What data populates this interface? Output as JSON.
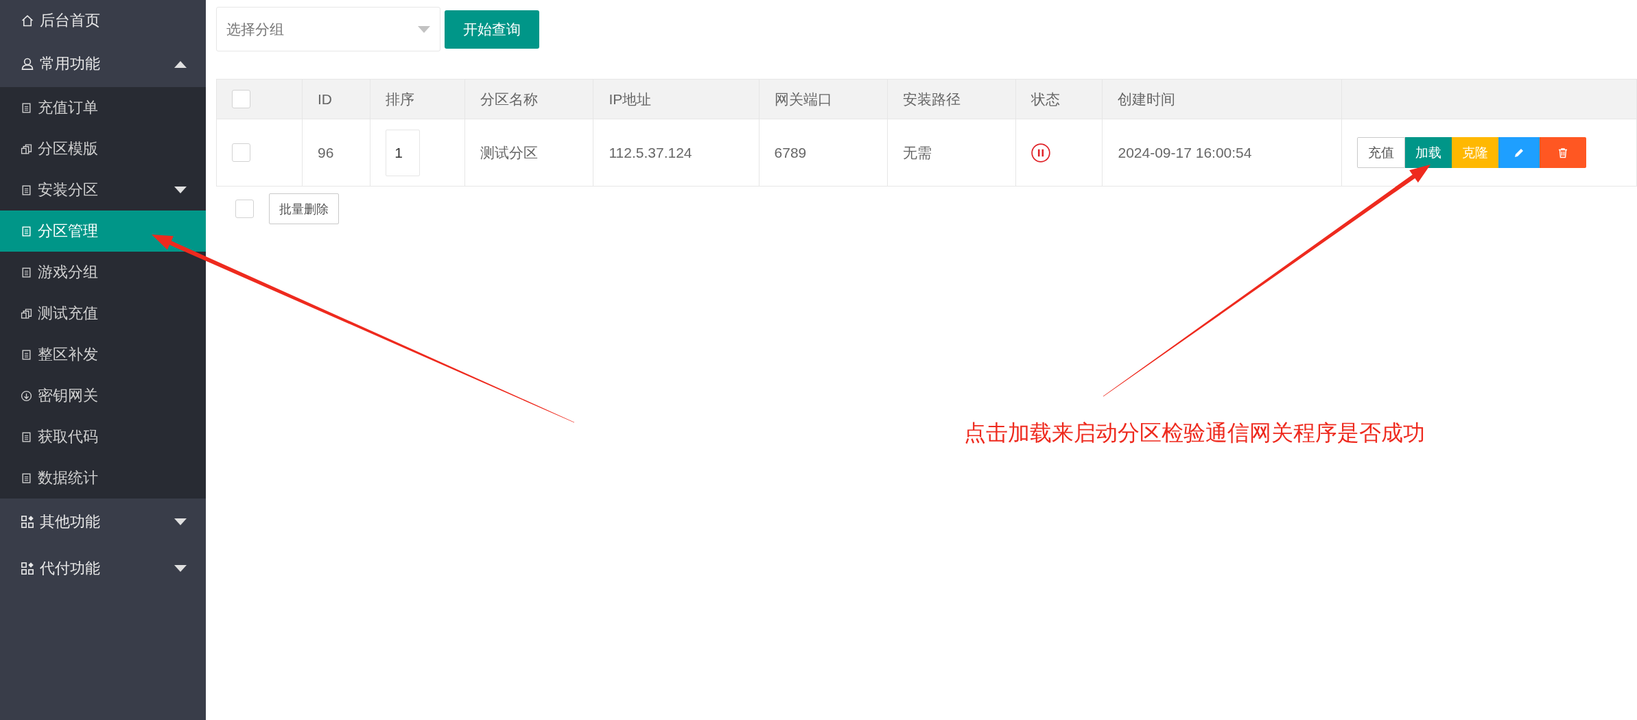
{
  "sidebar": {
    "items": [
      {
        "label": "后台首页",
        "kind": "link",
        "selected": false
      },
      {
        "label": "常用功能",
        "kind": "group",
        "expanded": true,
        "selected": false,
        "children": [
          {
            "label": "充值订单",
            "kind": "link",
            "selected": false
          },
          {
            "label": "分区模版",
            "kind": "link",
            "selected": false
          },
          {
            "label": "安装分区",
            "kind": "group",
            "expanded": false,
            "selected": false
          },
          {
            "label": "分区管理",
            "kind": "link",
            "selected": true
          },
          {
            "label": "游戏分组",
            "kind": "link",
            "selected": false
          },
          {
            "label": "测试充值",
            "kind": "link",
            "selected": false
          },
          {
            "label": "整区补发",
            "kind": "link",
            "selected": false
          },
          {
            "label": "密钥网关",
            "kind": "link",
            "selected": false
          },
          {
            "label": "获取代码",
            "kind": "link",
            "selected": false
          },
          {
            "label": "数据统计",
            "kind": "link",
            "selected": false
          }
        ]
      },
      {
        "label": "其他功能",
        "kind": "group",
        "expanded": false,
        "selected": false
      },
      {
        "label": "代付功能",
        "kind": "group",
        "expanded": false,
        "selected": false
      }
    ]
  },
  "toolbar": {
    "group_select": {
      "placeholder": "选择分组"
    },
    "search_button": "开始查询"
  },
  "table": {
    "header_checked": false,
    "columns": [
      "ID",
      "排序",
      "分区名称",
      "IP地址",
      "网关端口",
      "安装路径",
      "状态",
      "创建时间"
    ],
    "rows": [
      {
        "checked": false,
        "id": "96",
        "order": "1",
        "name": "测试分区",
        "ip": "112.5.37.124",
        "port": "6789",
        "path": "无需",
        "paused": true,
        "created": "2024-09-17 16:00:54",
        "actions": [
          {
            "kind": "default",
            "label": "充值"
          },
          {
            "kind": "primary",
            "label": "加载"
          },
          {
            "kind": "warm",
            "label": "克隆"
          },
          {
            "kind": "edit"
          },
          {
            "kind": "delete"
          }
        ]
      }
    ]
  },
  "bulk": {
    "checked": false,
    "button": "批量删除"
  },
  "annotation": {
    "text": "点击加载来启动分区检验通信网关程序是否成功"
  }
}
